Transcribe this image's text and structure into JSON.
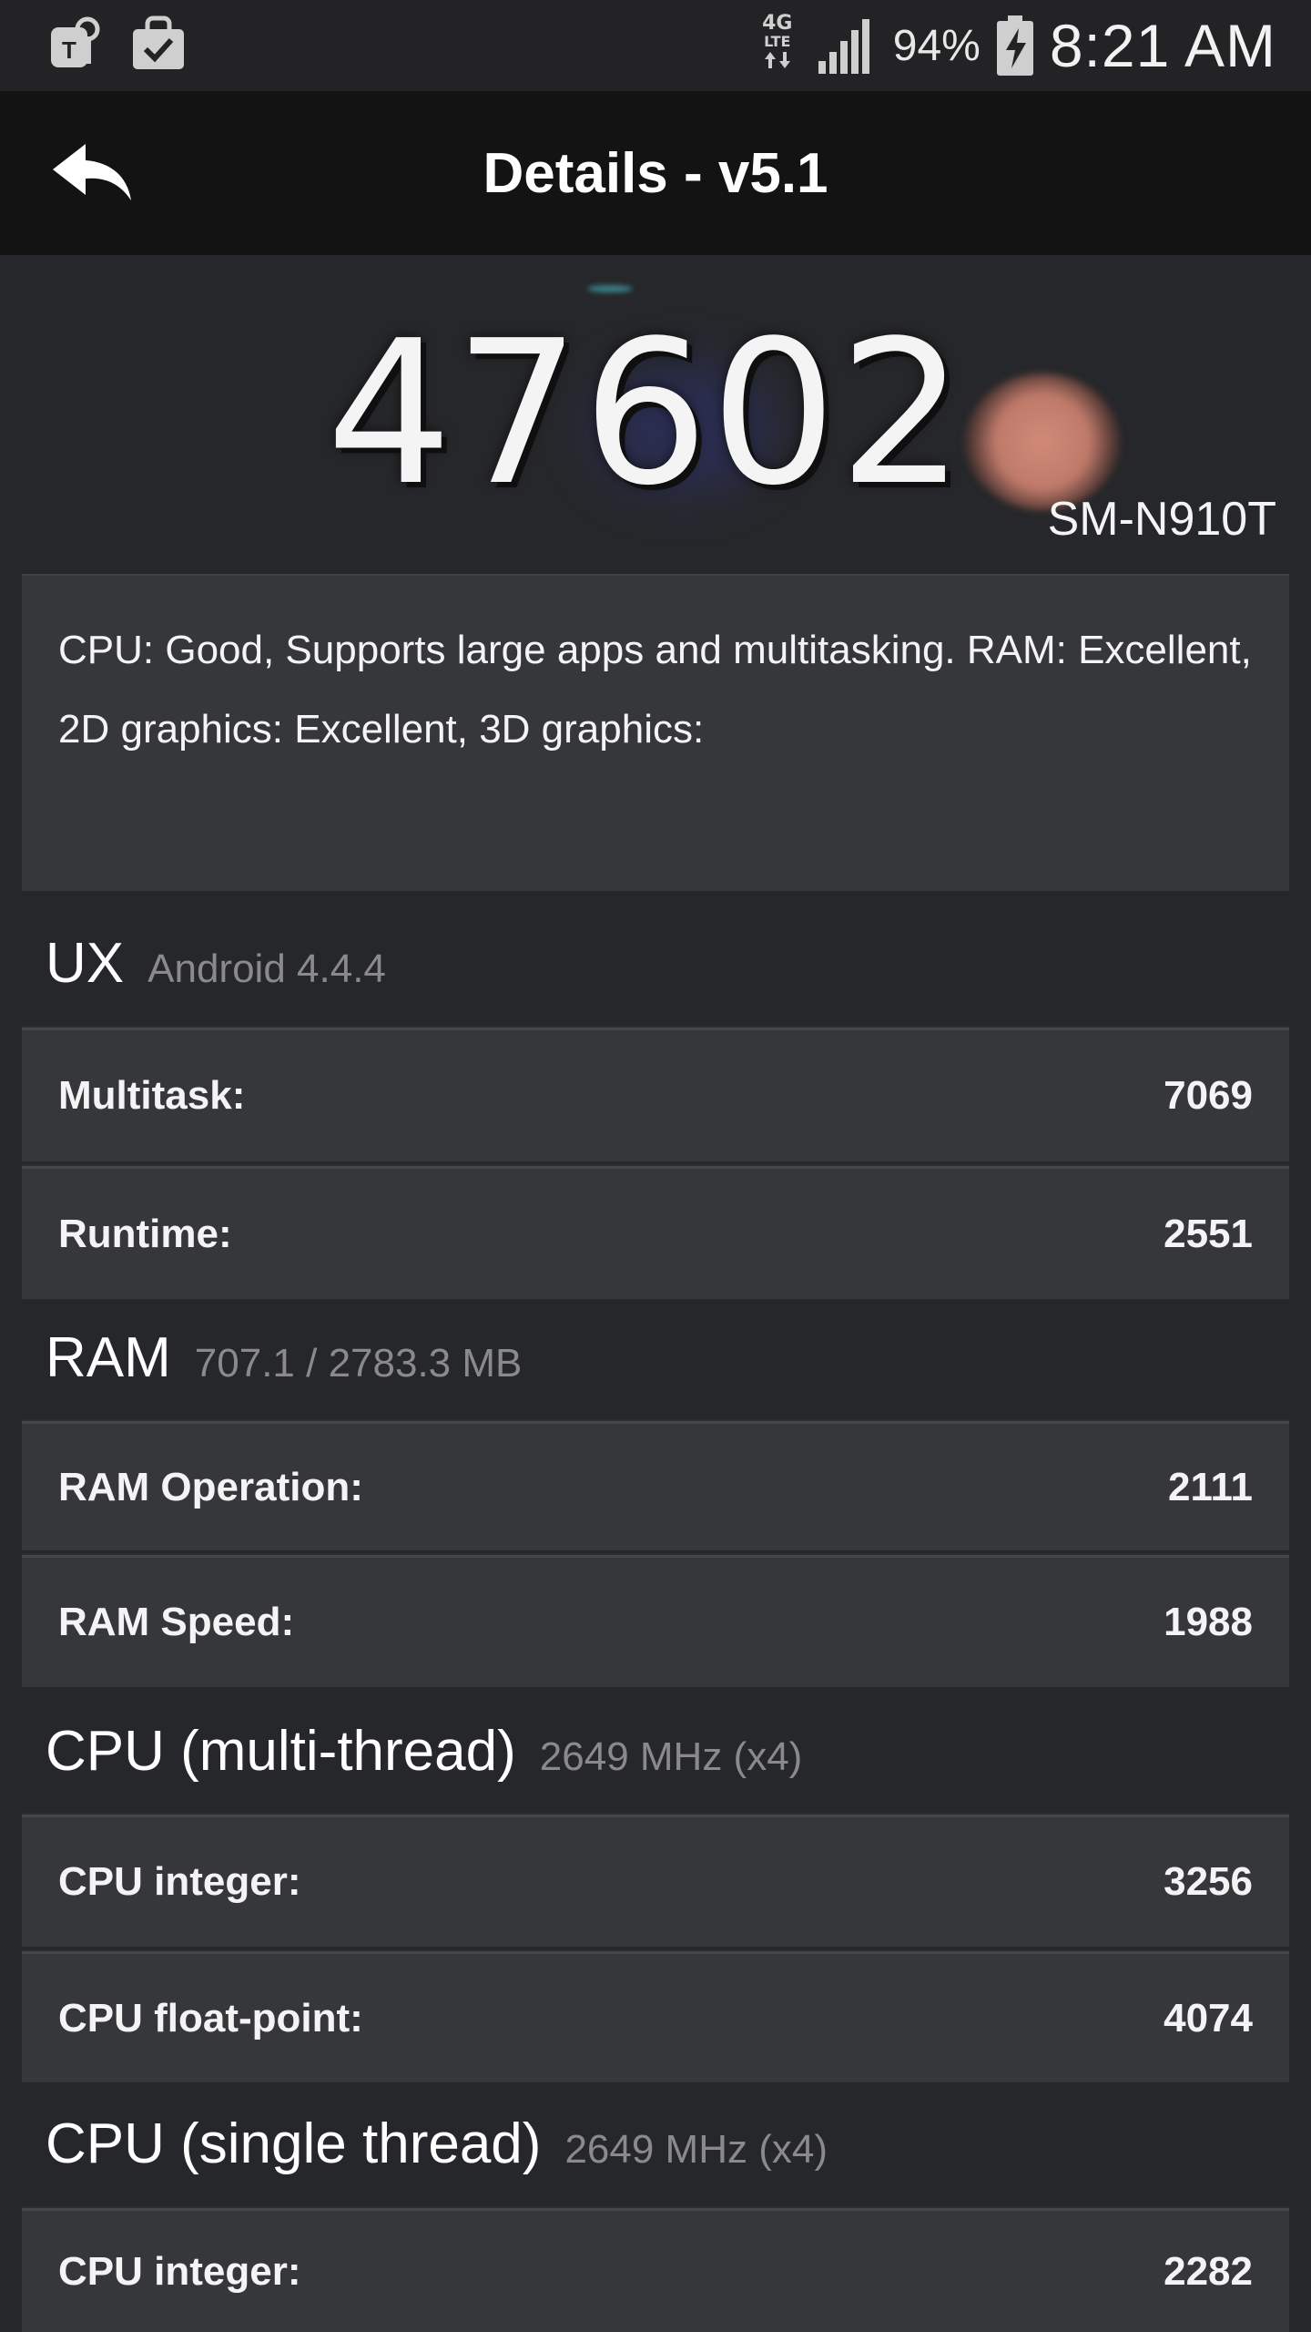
{
  "status_bar": {
    "network_type": "4G",
    "network_sub": "LTE",
    "battery_percent": "94%",
    "time": "8:21 AM"
  },
  "app_bar": {
    "title": "Details - v5.1"
  },
  "score": {
    "value": "47602",
    "device": "SM-N910T"
  },
  "summary": {
    "text": "CPU: Good, Supports large apps and multitasking. RAM: Excellent, 2D graphics: Excellent, 3D graphics:"
  },
  "sections": [
    {
      "title": "UX",
      "subtitle": "Android 4.4.4",
      "rows": [
        {
          "label": "Multitask:",
          "value": "7069"
        },
        {
          "label": "Runtime:",
          "value": "2551"
        }
      ]
    },
    {
      "title": "RAM",
      "subtitle": "707.1 / 2783.3 MB",
      "rows": [
        {
          "label": "RAM Operation:",
          "value": "2111"
        },
        {
          "label": "RAM Speed:",
          "value": "1988"
        }
      ]
    },
    {
      "title": "CPU (multi-thread)",
      "subtitle": "2649 MHz (x4)",
      "rows": [
        {
          "label": "CPU integer:",
          "value": "3256"
        },
        {
          "label": "CPU float-point:",
          "value": "4074"
        }
      ]
    },
    {
      "title": "CPU (single thread)",
      "subtitle": "2649 MHz (x4)",
      "rows": [
        {
          "label": "CPU integer:",
          "value": "2282"
        }
      ]
    }
  ],
  "colors": {
    "background": "#26272a",
    "card": "#36373b",
    "app_bar": "#131313",
    "subtitle_gray": "#8a8a8c"
  },
  "icons": [
    "tmobile-icon",
    "shopping-bag-check-icon",
    "lte-data-icon",
    "signal-icon",
    "battery-charging-icon",
    "back-arrow-icon"
  ]
}
